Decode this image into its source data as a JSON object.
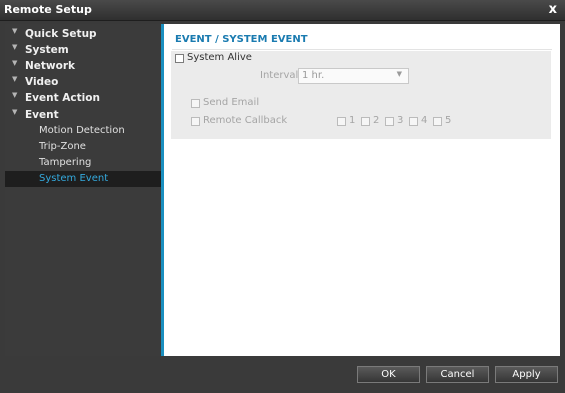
{
  "window": {
    "title": "Remote Setup",
    "close_glyph": "x"
  },
  "sidebar": {
    "items": [
      {
        "label": "Quick Setup"
      },
      {
        "label": "System"
      },
      {
        "label": "Network"
      },
      {
        "label": "Video"
      },
      {
        "label": "Event Action"
      },
      {
        "label": "Event"
      }
    ],
    "event_children": [
      {
        "label": "Motion Detection"
      },
      {
        "label": "Trip-Zone"
      },
      {
        "label": "Tampering"
      },
      {
        "label": "System Event",
        "selected": true
      }
    ]
  },
  "main": {
    "heading": "EVENT / SYSTEM EVENT",
    "system_alive": {
      "label": "System Alive",
      "checked": false
    },
    "interval": {
      "label": "Interval",
      "value": "1 hr."
    },
    "send_email": {
      "label": "Send Email",
      "checked": false,
      "enabled": false
    },
    "remote_callback": {
      "label": "Remote Callback",
      "enabled": false,
      "options": [
        "1",
        "2",
        "3",
        "4",
        "5"
      ]
    }
  },
  "footer": {
    "ok_label": "OK",
    "cancel_label": "Cancel",
    "apply_label": "Apply"
  },
  "colors": {
    "accent": "#1a8fbf",
    "selected_text": "#34a9dd",
    "heading": "#1a7bb0"
  }
}
